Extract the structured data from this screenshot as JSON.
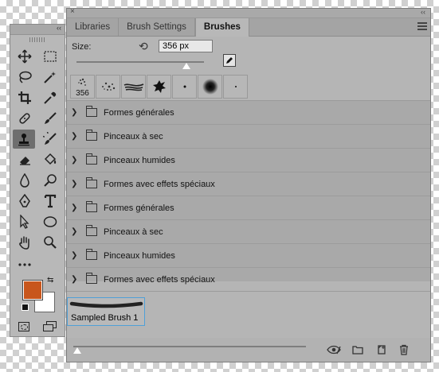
{
  "panel": {
    "tabs": [
      "Libraries",
      "Brush Settings",
      "Brushes"
    ],
    "active_tab": "Brushes",
    "size_label": "Size:",
    "size_value": "356 px",
    "size_slider_fraction": 0.86,
    "preset_first_number": "356",
    "folders": [
      "Formes générales",
      "Pinceaux à sec",
      "Pinceaux humides",
      "Formes avec effets spéciaux",
      "Formes générales",
      "Pinceaux à sec",
      "Pinceaux humides",
      "Formes avec effets spéciaux"
    ],
    "sampled_brush": "Sampled Brush 1"
  },
  "colors": {
    "foreground": "#c8561c",
    "background": "#ffffff",
    "selection_outline": "#4fa0d8"
  },
  "icons": {
    "tools": [
      "move-icon",
      "marquee-icon",
      "lasso-icon",
      "magic-wand-icon",
      "crop-icon",
      "eyedropper-icon",
      "healing-brush-icon",
      "brush-icon",
      "clone-stamp-icon",
      "history-brush-icon",
      "eraser-icon",
      "paint-bucket-icon",
      "blur-icon",
      "dodge-icon",
      "pen-icon",
      "type-icon",
      "path-select-icon",
      "ellipse-icon",
      "hand-icon",
      "zoom-icon",
      "more-tools-icon"
    ]
  }
}
